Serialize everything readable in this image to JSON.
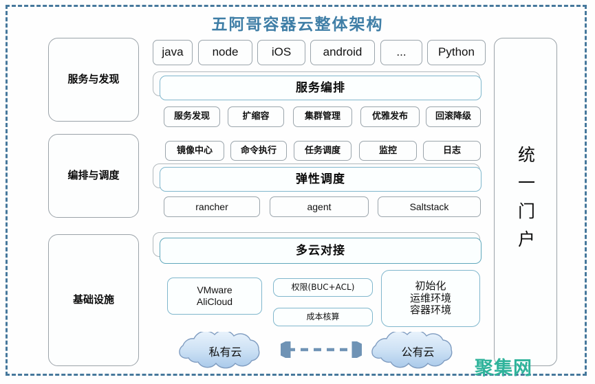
{
  "page": {
    "title": "五阿哥容器云整体架构",
    "watermark": "聚集网",
    "frame_color": "#46789c",
    "title_color": "#3f7ea6",
    "watermark_color": "#2fb39b"
  },
  "categories": [
    {
      "label": "服务与发现"
    },
    {
      "label": "编排与调度"
    },
    {
      "label": "基础设施"
    }
  ],
  "portal": {
    "label": "统一门户"
  },
  "layers": [
    {
      "name": "service-discovery",
      "top_chips": [
        {
          "label": "java"
        },
        {
          "label": "node"
        },
        {
          "label": "iOS"
        },
        {
          "label": "android"
        },
        {
          "label": "..."
        },
        {
          "label": "Python"
        }
      ],
      "bar": {
        "label": "服务编排"
      },
      "bottom_chips": [
        {
          "label": "服务发现"
        },
        {
          "label": "扩缩容"
        },
        {
          "label": "集群管理"
        },
        {
          "label": "优雅发布"
        },
        {
          "label": "回滚降级"
        }
      ]
    },
    {
      "name": "orchestration-scheduling",
      "top_chips": [
        {
          "label": "镜像中心"
        },
        {
          "label": "命令执行"
        },
        {
          "label": "任务调度"
        },
        {
          "label": "监控"
        },
        {
          "label": "日志"
        }
      ],
      "bar": {
        "label": "弹性调度"
      },
      "bottom_chips": [
        {
          "label": "rancher"
        },
        {
          "label": "agent"
        },
        {
          "label": "Saltstack"
        }
      ]
    },
    {
      "name": "infrastructure",
      "bar": {
        "label": "多云对接"
      },
      "bottom_chips": [
        {
          "label": "VMware\nAliCloud"
        },
        {
          "label": "权限(BUC+ACL)"
        },
        {
          "label": "成本核算"
        },
        {
          "label": "初始化\n运维环境\n容器环境"
        }
      ]
    }
  ],
  "clouds": {
    "private": {
      "label": "私有云"
    },
    "public": {
      "label": "公有云"
    },
    "connector": {
      "style": "dashed-double-arrow",
      "color": "#6f93b5"
    }
  }
}
